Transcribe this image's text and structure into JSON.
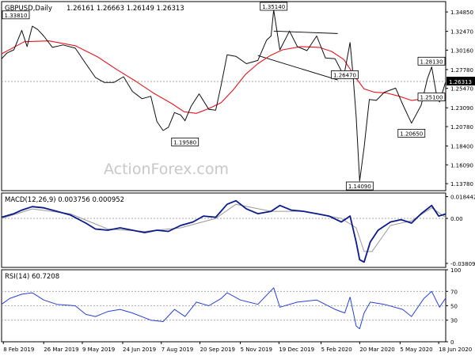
{
  "header": {
    "symbol": "GBPUSD,Daily",
    "ohlc": "1.26161 1.26663 1.26149 1.26313"
  },
  "watermark": "ActionForex.com",
  "colors": {
    "price": "#101010",
    "ma": "#e8141e",
    "macd": "#0a1a8c",
    "signal": "#9a9a9a",
    "rsi": "#2a3fd9",
    "frame": "#000000"
  },
  "x_axis": {
    "start_date": "2019-02-06",
    "end_date": "2020-06-26",
    "labels": [
      {
        "date": "2019-02-08",
        "text": "8 Feb 2019"
      },
      {
        "date": "2019-03-26",
        "text": "26 Mar 2019"
      },
      {
        "date": "2019-05-09",
        "text": "9 May 2019"
      },
      {
        "date": "2019-06-24",
        "text": "24 Jun 2019"
      },
      {
        "date": "2019-08-07",
        "text": "7 Aug 2019"
      },
      {
        "date": "2019-09-20",
        "text": "20 Sep 2019"
      },
      {
        "date": "2019-11-05",
        "text": "5 Nov 2019"
      },
      {
        "date": "2019-12-19",
        "text": "19 Dec 2019"
      },
      {
        "date": "2020-02-05",
        "text": "5 Feb 2020"
      },
      {
        "date": "2020-03-20",
        "text": "20 Mar 2020"
      },
      {
        "date": "2020-05-05",
        "text": "5 May 2020"
      },
      {
        "date": "2020-06-18",
        "text": "18 Jun 2020"
      }
    ]
  },
  "chart_data": [
    {
      "type": "line",
      "title": "GBPUSD,Daily",
      "ylim": [
        1.1292,
        1.3612
      ],
      "y_ticks": [
        "1.34850",
        "1.32470",
        "1.30160",
        "1.27780",
        "1.25470",
        "1.23090",
        "1.20780",
        "1.18400",
        "1.16090",
        "1.13780"
      ],
      "y_tick_values": [
        1.3485,
        1.3247,
        1.3016,
        1.2778,
        1.2547,
        1.2309,
        1.2078,
        1.184,
        1.1609,
        1.1378
      ],
      "current_price_label": "1.26313",
      "current_price": 1.26313,
      "series": [
        {
          "name": "Price",
          "x": [
            "2019-02-06",
            "2019-02-12",
            "2019-02-20",
            "2019-03-01",
            "2019-03-07",
            "2019-03-13",
            "2019-03-19",
            "2019-03-26",
            "2019-04-05",
            "2019-04-17",
            "2019-05-01",
            "2019-05-13",
            "2019-05-24",
            "2019-06-03",
            "2019-06-14",
            "2019-06-25",
            "2019-07-05",
            "2019-07-16",
            "2019-07-26",
            "2019-08-02",
            "2019-08-09",
            "2019-08-15",
            "2019-08-22",
            "2019-08-29",
            "2019-09-03",
            "2019-09-10",
            "2019-09-19",
            "2019-09-30",
            "2019-10-08",
            "2019-10-14",
            "2019-10-21",
            "2019-10-31",
            "2019-11-12",
            "2019-11-25",
            "2019-12-05",
            "2019-12-10",
            "2019-12-13",
            "2019-12-20",
            "2019-12-31",
            "2020-01-09",
            "2020-01-20",
            "2020-01-31",
            "2020-02-10",
            "2020-02-21",
            "2020-03-02",
            "2020-03-09",
            "2020-03-12",
            "2020-03-16",
            "2020-03-20",
            "2020-03-25",
            "2020-03-31",
            "2020-04-08",
            "2020-04-17",
            "2020-04-30",
            "2020-05-08",
            "2020-05-18",
            "2020-05-29",
            "2020-06-05",
            "2020-06-10",
            "2020-06-16",
            "2020-06-19",
            "2020-06-26"
          ],
          "y": [
            1.291,
            1.298,
            1.302,
            1.326,
            1.306,
            1.331,
            1.327,
            1.319,
            1.305,
            1.308,
            1.304,
            1.285,
            1.268,
            1.262,
            1.262,
            1.269,
            1.251,
            1.242,
            1.245,
            1.214,
            1.203,
            1.207,
            1.225,
            1.222,
            1.215,
            1.233,
            1.248,
            1.229,
            1.228,
            1.258,
            1.296,
            1.294,
            1.285,
            1.289,
            1.314,
            1.319,
            1.351,
            1.302,
            1.325,
            1.306,
            1.301,
            1.319,
            1.292,
            1.291,
            1.27,
            1.311,
            1.276,
            1.22,
            1.141,
            1.182,
            1.241,
            1.24,
            1.25,
            1.255,
            1.235,
            1.212,
            1.234,
            1.266,
            1.281,
            1.244,
            1.238,
            1.263
          ]
        },
        {
          "name": "Moving Average",
          "x": [
            "2019-02-06",
            "2019-03-04",
            "2019-04-01",
            "2019-05-01",
            "2019-05-27",
            "2019-06-17",
            "2019-07-08",
            "2019-07-29",
            "2019-08-19",
            "2019-09-02",
            "2019-09-16",
            "2019-09-30",
            "2019-10-14",
            "2019-10-28",
            "2019-11-11",
            "2019-11-25",
            "2019-12-09",
            "2019-12-23",
            "2020-01-13",
            "2020-02-03",
            "2020-02-17",
            "2020-03-02",
            "2020-03-16",
            "2020-03-25",
            "2020-04-06",
            "2020-04-20",
            "2020-05-04",
            "2020-05-18",
            "2020-06-01",
            "2020-06-15",
            "2020-06-26"
          ],
          "y": [
            1.297,
            1.312,
            1.313,
            1.307,
            1.293,
            1.278,
            1.264,
            1.249,
            1.236,
            1.226,
            1.224,
            1.23,
            1.237,
            1.253,
            1.272,
            1.285,
            1.295,
            1.302,
            1.306,
            1.305,
            1.3,
            1.29,
            1.267,
            1.254,
            1.25,
            1.249,
            1.245,
            1.24,
            1.242,
            1.245,
            1.248
          ]
        }
      ],
      "channel_lines": [
        {
          "x": [
            "2019-12-13",
            "2020-02-24"
          ],
          "y": [
            1.325,
            1.322
          ]
        },
        {
          "x": [
            "2019-11-25",
            "2020-02-24"
          ],
          "y": [
            1.295,
            1.265
          ]
        }
      ],
      "annotations": [
        {
          "text": "1.33810",
          "x": "2019-02-06",
          "y": 1.3381
        },
        {
          "text": "1.35140",
          "x": "2019-12-13",
          "y": 1.3514
        },
        {
          "text": "1.28130",
          "x": "2020-06-10",
          "y": 1.2813
        },
        {
          "text": "1.26470",
          "x": "2020-03-03",
          "y": 1.2647
        },
        {
          "text": "1.25100",
          "x": "2020-06-19",
          "y": 1.251
        },
        {
          "text": "1.20650",
          "x": "2020-05-18",
          "y": 1.2065
        },
        {
          "text": "1.19580",
          "x": "2019-09-03",
          "y": 1.1958
        },
        {
          "text": "1.14090",
          "x": "2020-03-20",
          "y": 1.1409
        }
      ]
    },
    {
      "type": "line",
      "title": "MACD(12,26,9) 0.003756 0.000952",
      "ylim": [
        -0.0415,
        0.0215
      ],
      "y_ticks": [
        "0.018442",
        "0.00",
        "-0.038095"
      ],
      "y_tick_values": [
        0.018442,
        0.0,
        -0.038095
      ],
      "series": [
        {
          "name": "MACD",
          "x": [
            "2019-02-06",
            "2019-02-20",
            "2019-03-01",
            "2019-03-13",
            "2019-03-26",
            "2019-04-10",
            "2019-04-25",
            "2019-05-13",
            "2019-05-24",
            "2019-06-07",
            "2019-06-21",
            "2019-07-05",
            "2019-07-19",
            "2019-08-02",
            "2019-08-15",
            "2019-08-29",
            "2019-09-12",
            "2019-09-24",
            "2019-10-08",
            "2019-10-21",
            "2019-10-31",
            "2019-11-12",
            "2019-11-25",
            "2019-12-10",
            "2019-12-20",
            "2020-01-02",
            "2020-01-16",
            "2020-01-31",
            "2020-02-14",
            "2020-02-28",
            "2020-03-09",
            "2020-03-16",
            "2020-03-20",
            "2020-03-25",
            "2020-04-01",
            "2020-04-10",
            "2020-04-24",
            "2020-05-06",
            "2020-05-18",
            "2020-05-29",
            "2020-06-10",
            "2020-06-18",
            "2020-06-26"
          ],
          "y": [
            0.001,
            0.004,
            0.007,
            0.01,
            0.009,
            0.006,
            0.003,
            -0.004,
            -0.009,
            -0.01,
            -0.008,
            -0.01,
            -0.012,
            -0.01,
            -0.011,
            -0.006,
            -0.003,
            0.002,
            0.001,
            0.012,
            0.015,
            0.008,
            0.004,
            0.006,
            0.011,
            0.007,
            0.006,
            0.004,
            0.002,
            -0.003,
            0.002,
            -0.02,
            -0.035,
            -0.037,
            -0.02,
            -0.01,
            -0.003,
            -0.001,
            -0.004,
            0.004,
            0.011,
            0.002,
            0.003756
          ]
        },
        {
          "name": "Signal",
          "x": [
            "2019-02-06",
            "2019-03-13",
            "2019-04-25",
            "2019-06-07",
            "2019-07-19",
            "2019-08-29",
            "2019-10-08",
            "2019-10-31",
            "2019-12-10",
            "2020-01-16",
            "2020-02-28",
            "2020-03-16",
            "2020-03-25",
            "2020-04-03",
            "2020-04-24",
            "2020-05-18",
            "2020-06-10",
            "2020-06-26"
          ],
          "y": [
            0.0,
            0.008,
            0.004,
            -0.009,
            -0.011,
            -0.008,
            0.0,
            0.012,
            0.006,
            0.006,
            0.0,
            -0.008,
            -0.028,
            -0.028,
            -0.006,
            -0.002,
            0.009,
            0.000952
          ]
        }
      ]
    },
    {
      "type": "line",
      "title": "RSI(14) 60.7208",
      "ylim": [
        0,
        100
      ],
      "y_ticks": [
        "100",
        "70",
        "50",
        "30",
        "0"
      ],
      "y_tick_values": [
        100,
        70,
        50,
        30,
        0
      ],
      "series": [
        {
          "name": "RSI",
          "x": [
            "2019-02-06",
            "2019-02-15",
            "2019-03-01",
            "2019-03-13",
            "2019-03-26",
            "2019-04-10",
            "2019-05-01",
            "2019-05-13",
            "2019-05-24",
            "2019-06-07",
            "2019-06-21",
            "2019-07-05",
            "2019-07-26",
            "2019-08-09",
            "2019-08-22",
            "2019-09-03",
            "2019-09-16",
            "2019-09-30",
            "2019-10-14",
            "2019-10-21",
            "2019-11-05",
            "2019-11-25",
            "2019-12-13",
            "2019-12-20",
            "2020-01-09",
            "2020-01-31",
            "2020-02-21",
            "2020-03-03",
            "2020-03-09",
            "2020-03-16",
            "2020-03-20",
            "2020-03-25",
            "2020-04-01",
            "2020-04-17",
            "2020-05-08",
            "2020-05-18",
            "2020-06-01",
            "2020-06-10",
            "2020-06-19",
            "2020-06-26"
          ],
          "y": [
            52,
            60,
            66,
            68,
            58,
            52,
            50,
            38,
            35,
            42,
            45,
            40,
            30,
            28,
            45,
            35,
            55,
            50,
            60,
            68,
            58,
            52,
            75,
            48,
            55,
            58,
            45,
            40,
            62,
            22,
            18,
            40,
            55,
            52,
            45,
            35,
            60,
            70,
            48,
            60.7208
          ]
        }
      ]
    }
  ]
}
